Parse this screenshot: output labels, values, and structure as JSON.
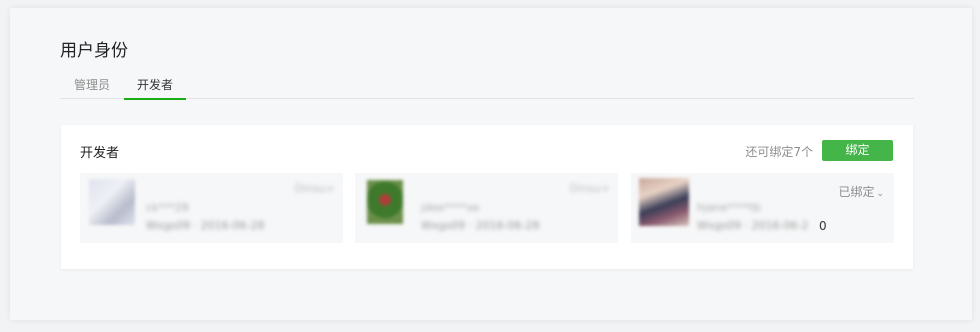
{
  "page": {
    "title": "用户身份"
  },
  "tabs": [
    {
      "label": "管理员",
      "active": false
    },
    {
      "label": "开发者",
      "active": true
    }
  ],
  "developers": {
    "title": "开发者",
    "remaining": "还可绑定7个",
    "bind_button": "绑定",
    "items": [
      {
        "name": "ck***28",
        "meta": "Wxgs09 · 2016-06-28",
        "tag": "Dinsu+",
        "avatar_colors": [
          "#dfe3ee",
          "#b8bccb"
        ]
      },
      {
        "name": "jdee****xe",
        "meta": "Wxgs09 · 2016-06-28",
        "tag": "Dinsu+",
        "avatar_colors": [
          "#3f7a2c",
          "#b33a3a"
        ]
      },
      {
        "name": "hjane****tb",
        "meta": "Wxgs09 · 2016-06-2",
        "bound_label": "已绑定",
        "bound_chevron": "⌄",
        "trail": "0",
        "avatar_colors": [
          "#c9a89a",
          "#3b3e58"
        ]
      }
    ]
  },
  "colors": {
    "accent": "#44b549",
    "tab_underline": "#1aad19"
  }
}
